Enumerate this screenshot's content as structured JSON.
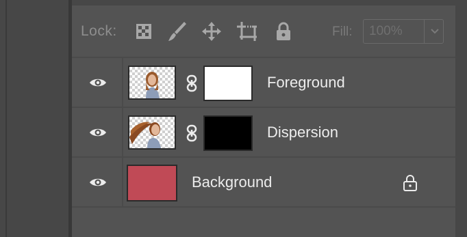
{
  "lockbar": {
    "lock_label": "Lock:",
    "icons": [
      "lock-transparent-pixels-icon",
      "lock-image-pixels-icon",
      "lock-position-icon",
      "lock-artboard-icon",
      "lock-all-icon"
    ],
    "fill_label": "Fill:",
    "fill_value": "100%"
  },
  "layers": [
    {
      "name": "Foreground",
      "mask": "white",
      "visible": true,
      "thumb": "portrait-transparent"
    },
    {
      "name": "Dispersion",
      "mask": "black",
      "visible": true,
      "thumb": "portrait-hair-dispersion"
    },
    {
      "name": "Background",
      "locked": true,
      "visible": true,
      "color": "#c04a56"
    }
  ],
  "colors": {
    "panel": "#535353",
    "text": "#ececec",
    "muted": "#8e8e8e",
    "background_swatch": "#c04a56"
  }
}
